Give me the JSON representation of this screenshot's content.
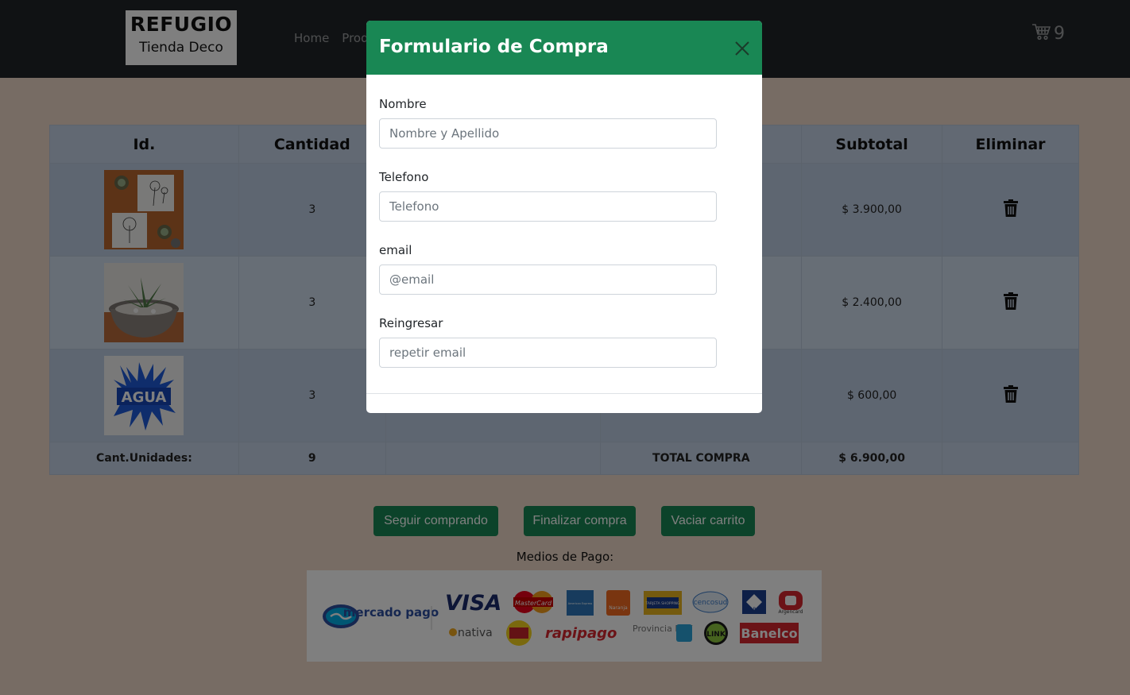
{
  "brand": {
    "title": "REFUGIO",
    "subtitle": "Tienda Deco"
  },
  "nav": {
    "home": "Home",
    "products_partial": "Prod"
  },
  "cart": {
    "count": "9"
  },
  "table": {
    "headers": {
      "id": "Id.",
      "cantidad": "Cantidad",
      "subtotal": "Subtotal",
      "eliminar": "Eliminar"
    },
    "rows": [
      {
        "image": "dandelion-prints-image",
        "cantidad": "3",
        "subtotal": "$ 3.900,00"
      },
      {
        "image": "succulent-pot-image",
        "cantidad": "3",
        "subtotal": "$ 2.400,00"
      },
      {
        "image": "agua-print-image",
        "cantidad": "3",
        "subtotal": "$ 600,00"
      }
    ],
    "footer": {
      "label": "Cant.Unidades:",
      "units": "9",
      "total_label": "TOTAL COMPRA",
      "total": "$ 6.900,00"
    }
  },
  "buttons": {
    "seguir": "Seguir comprando",
    "finalizar": "Finalizar compra",
    "vaciar": "Vaciar carrito"
  },
  "payment": {
    "title": "Medios de Pago:",
    "logos": [
      "mercado pago",
      "VISA",
      "MasterCard",
      "American Express",
      "Naranja",
      "TARJETA SHOPPING",
      "cencosud",
      "CABAL",
      "Argencard",
      "nativa",
      "rapipago",
      "Provincia NET",
      "LINK",
      "Banelco"
    ]
  },
  "modal": {
    "title": "Formulario de Compra",
    "fields": [
      {
        "label": "Nombre",
        "placeholder": "Nombre y Apellido"
      },
      {
        "label": "Telefono",
        "placeholder": "Telefono"
      },
      {
        "label": "email",
        "placeholder": "@email"
      },
      {
        "label": "Reingresar",
        "placeholder": "repetir email"
      }
    ]
  },
  "colors": {
    "accent": "#198754",
    "navbar": "#212529",
    "page_bg": "#efd9c8"
  }
}
